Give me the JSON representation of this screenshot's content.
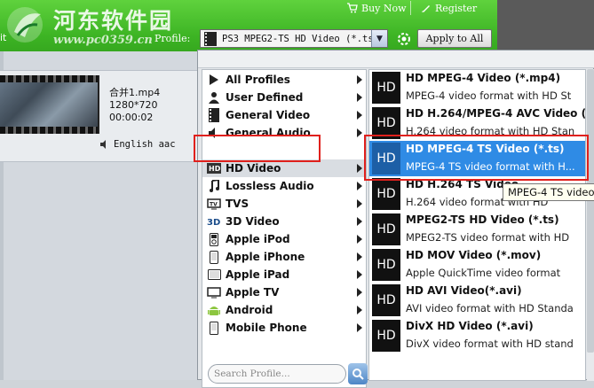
{
  "header": {
    "site_name": "河东软件园",
    "site_url": "www.pc0359.cn",
    "buy_now": "Buy Now",
    "register": "Register",
    "profile_label": "Profile:",
    "profile_value": "PS3 MPEG2-TS HD Video (*.ts",
    "apply_to_all": "Apply to All",
    "left_edge_text": "it"
  },
  "file": {
    "name": "合并1.mp4",
    "resolution": "1280*720",
    "duration": "00:00:02",
    "audio": "English aac"
  },
  "categories": [
    {
      "label": "All Profiles",
      "icon": "play-triangle-icon"
    },
    {
      "label": "User Defined",
      "icon": "user-icon"
    },
    {
      "label": "General Video",
      "icon": "film-icon"
    },
    {
      "label": "General Audio",
      "icon": "audio-icon"
    },
    {
      "label": "HD Video",
      "icon": "hd-icon",
      "selected": true
    },
    {
      "label": "Lossless Audio",
      "icon": "music-note-icon"
    },
    {
      "label": "TVS",
      "icon": "tv-icon"
    },
    {
      "label": "3D Video",
      "icon": "3d-icon"
    },
    {
      "label": "Apple iPod",
      "icon": "ipod-icon"
    },
    {
      "label": "Apple iPhone",
      "icon": "iphone-icon"
    },
    {
      "label": "Apple iPad",
      "icon": "ipad-icon"
    },
    {
      "label": "Apple TV",
      "icon": "apple-tv-icon"
    },
    {
      "label": "Android",
      "icon": "android-icon"
    },
    {
      "label": "Mobile Phone",
      "icon": "mobile-phone-icon"
    }
  ],
  "search_placeholder": "Search Profile...",
  "formats": [
    {
      "title": "HD MPEG-4 Video (*.mp4)",
      "desc": "MPEG-4 video format with HD St"
    },
    {
      "title": "HD H.264/MPEG-4 AVC Video (*",
      "desc": "H.264 video format with HD Stan"
    },
    {
      "title": "HD MPEG-4 TS Video (*.ts)",
      "desc": "MPEG-4 TS video format with H...",
      "selected": true
    },
    {
      "title": "HD H.264 TS Video",
      "desc": "H.264 video format with HD"
    },
    {
      "title": "MPEG2-TS HD Video (*.ts)",
      "desc": "MPEG2-TS video format with HD"
    },
    {
      "title": "HD MOV Video (*.mov)",
      "desc": "Apple QuickTime video format"
    },
    {
      "title": "HD AVI Video(*.avi)",
      "desc": "AVI video format with HD Standa"
    },
    {
      "title": "DivX HD Video (*.avi)",
      "desc": "DivX video format with HD stand"
    }
  ],
  "format_icon_text": "HD",
  "tooltip": "MPEG-4 TS video",
  "colors": {
    "header_green": "#3db424",
    "selection_blue": "#2f8be5",
    "highlight_red": "#e0201c"
  }
}
